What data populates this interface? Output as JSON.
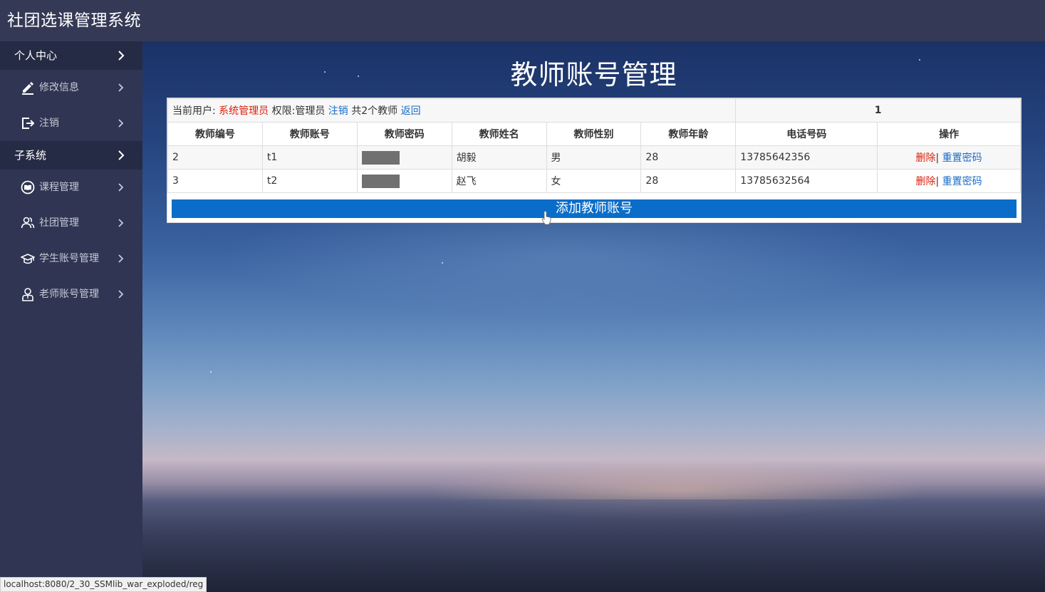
{
  "app": {
    "title": "社团选课管理系统"
  },
  "sidebar": {
    "groups": [
      {
        "label": "个人中心",
        "items": [
          {
            "label": "修改信息",
            "icon": "edit-icon"
          },
          {
            "label": "注销",
            "icon": "logout-icon"
          }
        ]
      },
      {
        "label": "子系统",
        "items": [
          {
            "label": "课程管理",
            "icon": "book-icon"
          },
          {
            "label": "社团管理",
            "icon": "users-icon"
          },
          {
            "label": "学生账号管理",
            "icon": "graduation-cap-icon"
          },
          {
            "label": "老师账号管理",
            "icon": "teacher-icon"
          }
        ]
      }
    ]
  },
  "page": {
    "title": "教师账号管理"
  },
  "info": {
    "current_user_label": "当前用户:",
    "current_user": "系统管理员",
    "permission_label": "权限:管理员",
    "logout_link": "注销",
    "count_text": "共2个教师",
    "back_link": "返回",
    "page_number": "1"
  },
  "table": {
    "headers": [
      "教师编号",
      "教师账号",
      "教师密码",
      "教师姓名",
      "教师性别",
      "教师年龄",
      "电话号码",
      "操作"
    ],
    "rows": [
      {
        "id": "2",
        "account": "t1",
        "name": "胡毅",
        "gender": "男",
        "age": "28",
        "phone": "13785642356"
      },
      {
        "id": "3",
        "account": "t2",
        "name": "赵飞",
        "gender": "女",
        "age": "28",
        "phone": "13785632564"
      }
    ],
    "delete_label": "删除",
    "separator": "|",
    "reset_label": "重置密码"
  },
  "add_button": {
    "label": "添加教师账号"
  },
  "statusbar": {
    "url": "localhost:8080/2_30_SSMlib_war_exploded/reg"
  },
  "colors": {
    "header_bg": "#343a56",
    "sidebar_bg": "#2f3552",
    "accent": "#0a6dc9",
    "danger": "#d9230f",
    "link": "#1a6dc6"
  }
}
